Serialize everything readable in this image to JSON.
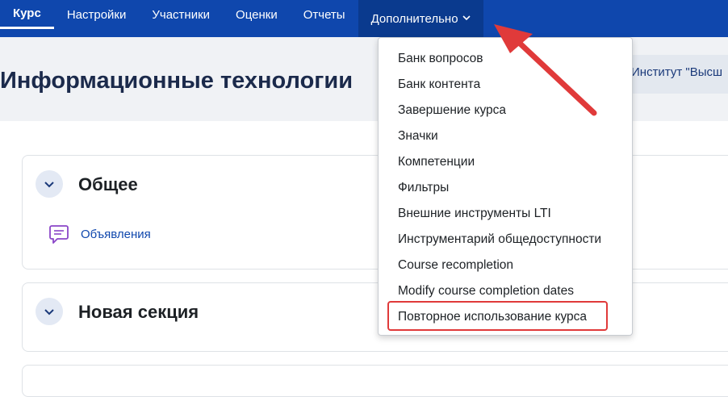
{
  "nav": {
    "items": [
      "Курс",
      "Настройки",
      "Участники",
      "Оценки",
      "Отчеты",
      "Дополнительно"
    ]
  },
  "page": {
    "title": "Информационные технологии",
    "institute": "Институт \"Высш"
  },
  "sections": [
    {
      "title": "Общее",
      "activity": "Объявления",
      "activity_icon": "forum-icon"
    },
    {
      "title": "Новая секция"
    }
  ],
  "dropdown": {
    "items": [
      "Банк вопросов",
      "Банк контента",
      "Завершение курса",
      "Значки",
      "Компетенции",
      "Фильтры",
      "Внешние инструменты LTI",
      "Инструментарий общедоступности",
      "Course recompletion",
      "Modify course completion dates",
      "Повторное использование курса"
    ],
    "highlighted": "Повторное использование курса"
  },
  "colors": {
    "navbar": "#0f47ad",
    "annotation": "#e03a3a",
    "link": "#0f47ad"
  }
}
